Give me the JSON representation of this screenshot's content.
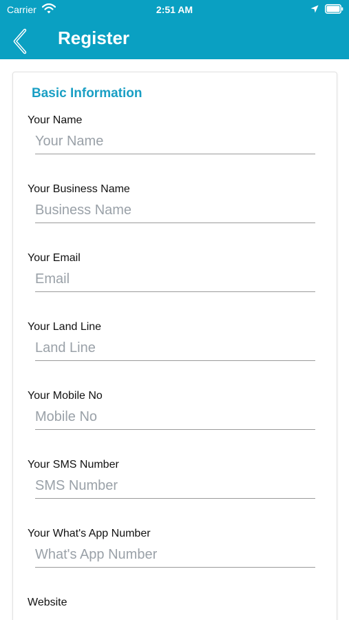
{
  "status_bar": {
    "carrier": "Carrier",
    "time": "2:51 AM"
  },
  "nav": {
    "title": "Register",
    "back_icon": "chevron-left-icon"
  },
  "section": {
    "title": "Basic Information"
  },
  "fields": [
    {
      "label": "Your Name",
      "placeholder": "Your Name",
      "value": ""
    },
    {
      "label": "Your Business Name",
      "placeholder": "Business Name",
      "value": ""
    },
    {
      "label": "Your Email",
      "placeholder": "Email",
      "value": ""
    },
    {
      "label": "Your Land Line",
      "placeholder": "Land Line",
      "value": ""
    },
    {
      "label": "Your Mobile No",
      "placeholder": "Mobile No",
      "value": ""
    },
    {
      "label": "Your SMS Number",
      "placeholder": "SMS Number",
      "value": ""
    },
    {
      "label": "Your What's App Number",
      "placeholder": "What's App Number",
      "value": ""
    },
    {
      "label": "Website"
    }
  ],
  "colors": {
    "header": "#0aa0c2",
    "section_title": "#1a9fc4"
  }
}
